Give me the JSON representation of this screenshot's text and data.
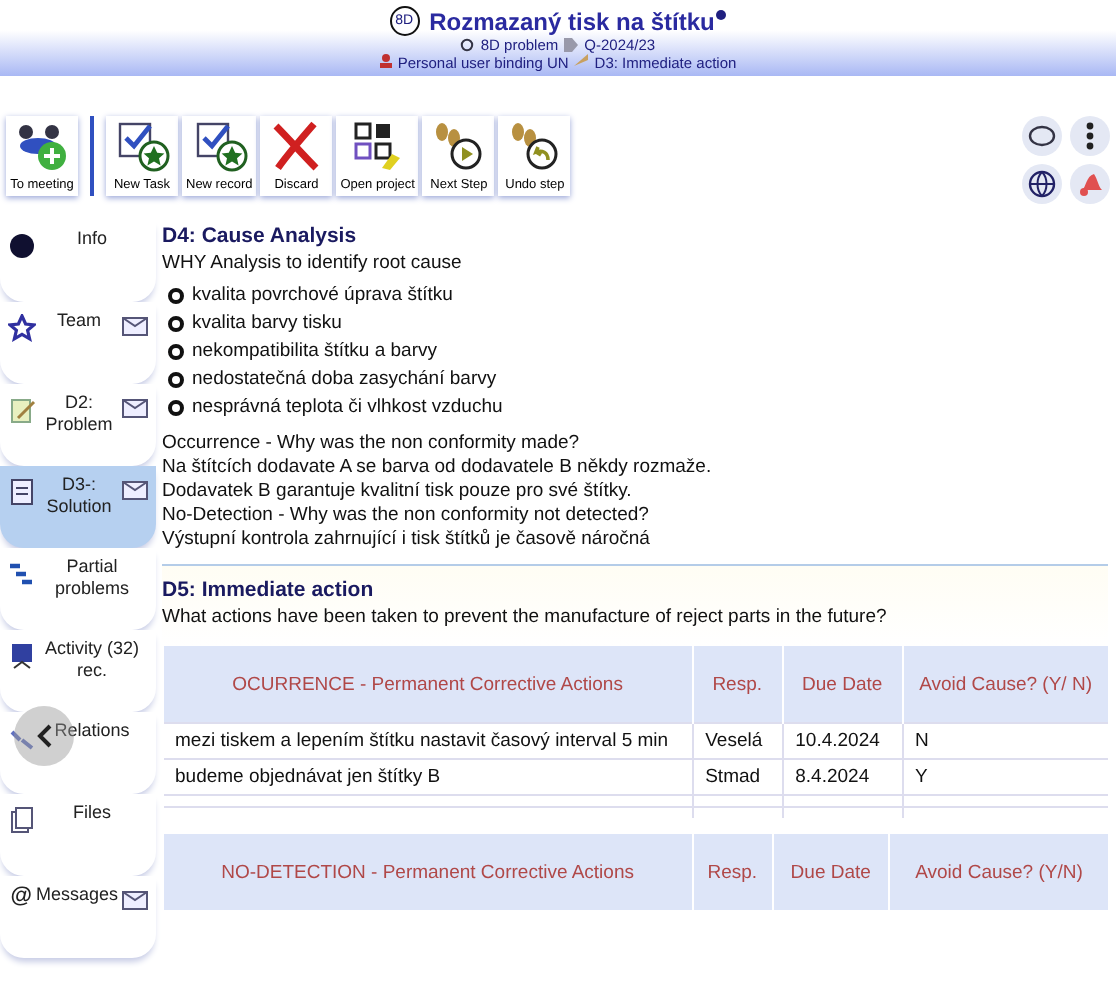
{
  "header": {
    "badge": "8D",
    "title": "Rozmazaný tisk na štítku",
    "type": "8D problem",
    "number": "Q-2024/23",
    "owner": "Personal user binding UN",
    "step": "D3: Immediate action"
  },
  "toolbar": [
    {
      "label": "To meeting",
      "kind": "meeting"
    },
    {
      "label": "New Task",
      "kind": "task"
    },
    {
      "label": "New record",
      "kind": "record"
    },
    {
      "label": "Discard",
      "kind": "discard"
    },
    {
      "label": "Open project",
      "kind": "project"
    },
    {
      "label": "Next Step",
      "kind": "next"
    },
    {
      "label": "Undo step",
      "kind": "undo"
    }
  ],
  "sidebar": {
    "items": [
      {
        "label": "Info",
        "kind": "dot",
        "mail": false,
        "selected": false
      },
      {
        "label": "Team",
        "kind": "star",
        "mail": true,
        "selected": false
      },
      {
        "label": "D2: Problem",
        "kind": "note",
        "mail": true,
        "selected": false
      },
      {
        "label": "D3-: Solution",
        "kind": "doc",
        "mail": true,
        "selected": true
      },
      {
        "label": "Partial problems",
        "kind": "tree",
        "mail": false,
        "selected": false
      },
      {
        "label": "Activity (32) rec.",
        "kind": "board",
        "mail": false,
        "selected": false
      },
      {
        "label": "Relations",
        "kind": "link",
        "mail": false,
        "selected": false
      },
      {
        "label": "Files",
        "kind": "files",
        "mail": false,
        "selected": false
      },
      {
        "label": "Messages",
        "kind": "at",
        "icon_char": "@",
        "mail": true,
        "selected": false
      }
    ]
  },
  "d4": {
    "title": "D4: Cause Analysis",
    "subtitle": "WHY Analysis to identify root cause",
    "causes": [
      "kvalita povrchové úprava štítku",
      "kvalita barvy tisku",
      "nekompatibilita štítku a barvy",
      "nedostatečná doba zasychání barvy",
      "nesprávná teplota či vlhkost vzduchu"
    ],
    "lines": [
      "Occurrence - Why was the non conformity made?",
      "Na štítcích dodavate A se barva od dodavatele B někdy rozmaže.",
      "Dodavatek B garantuje kvalitní tisk pouze pro své štítky.",
      "No-Detection - Why was the non conformity not detected?",
      "Výstupní kontrola zahrnující i tisk štítků je časově náročná"
    ]
  },
  "d5": {
    "title": "D5: Immediate action",
    "question": "What actions have been taken to prevent the manufacture of reject parts in the future?",
    "tables": [
      {
        "columns": [
          "OCURRENCE - Permanent Corrective Actions",
          "Resp.",
          "Due Date",
          "Avoid Cause? (Y/ N)"
        ],
        "rows": [
          [
            "mezi tiskem a lepením štítku nastavit časový interval 5 min",
            "Veselá",
            "10.4.2024",
            "N"
          ],
          [
            "budeme objednávat jen štítky B",
            "Stmad",
            "8.4.2024",
            "Y"
          ]
        ]
      },
      {
        "columns": [
          "NO-DETECTION - Permanent Corrective Actions",
          "Resp.",
          "Due Date",
          "Avoid Cause? (Y/N)"
        ]
      }
    ]
  }
}
